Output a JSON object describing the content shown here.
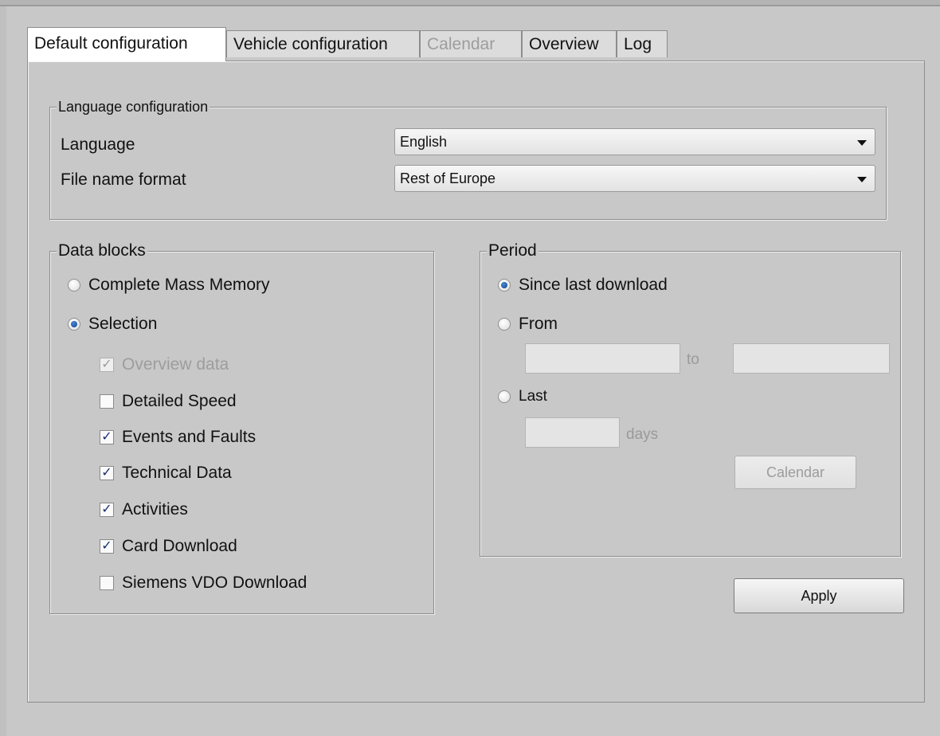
{
  "tabs": [
    {
      "label": "Default configuration",
      "active": true,
      "disabled": false
    },
    {
      "label": "Vehicle configuration",
      "active": false,
      "disabled": false
    },
    {
      "label": "Calendar",
      "active": false,
      "disabled": true
    },
    {
      "label": "Overview",
      "active": false,
      "disabled": false
    },
    {
      "label": "Log",
      "active": false,
      "disabled": false
    }
  ],
  "language_config": {
    "legend": "Language configuration",
    "language_label": "Language",
    "language_value": "English",
    "file_name_format_label": "File name format",
    "file_name_format_value": "Rest of Europe"
  },
  "data_blocks": {
    "legend": "Data blocks",
    "radios": [
      {
        "label": "Complete Mass Memory",
        "selected": false
      },
      {
        "label": "Selection",
        "selected": true
      }
    ],
    "checkboxes": [
      {
        "label": "Overview data",
        "checked": true,
        "disabled": true
      },
      {
        "label": "Detailed Speed",
        "checked": false,
        "disabled": false
      },
      {
        "label": "Events and Faults",
        "checked": true,
        "disabled": false
      },
      {
        "label": "Technical Data",
        "checked": true,
        "disabled": false
      },
      {
        "label": "Activities",
        "checked": true,
        "disabled": false
      },
      {
        "label": "Card Download",
        "checked": true,
        "disabled": false
      },
      {
        "label": "Siemens VDO Download",
        "checked": false,
        "disabled": false
      }
    ]
  },
  "period": {
    "legend": "Period",
    "since_last_download_label": "Since last download",
    "from_label": "From",
    "from_value": "",
    "to_label": "to",
    "to_value": "",
    "last_label": "Last",
    "days_value": "",
    "days_label": "days",
    "selected": "since_last_download",
    "calendar_button": "Calendar"
  },
  "apply_button": "Apply",
  "colors": {
    "accent_radio": "#0c3f86",
    "check_mark": "#1a2d72",
    "disabled_text": "#9d9d9d"
  }
}
